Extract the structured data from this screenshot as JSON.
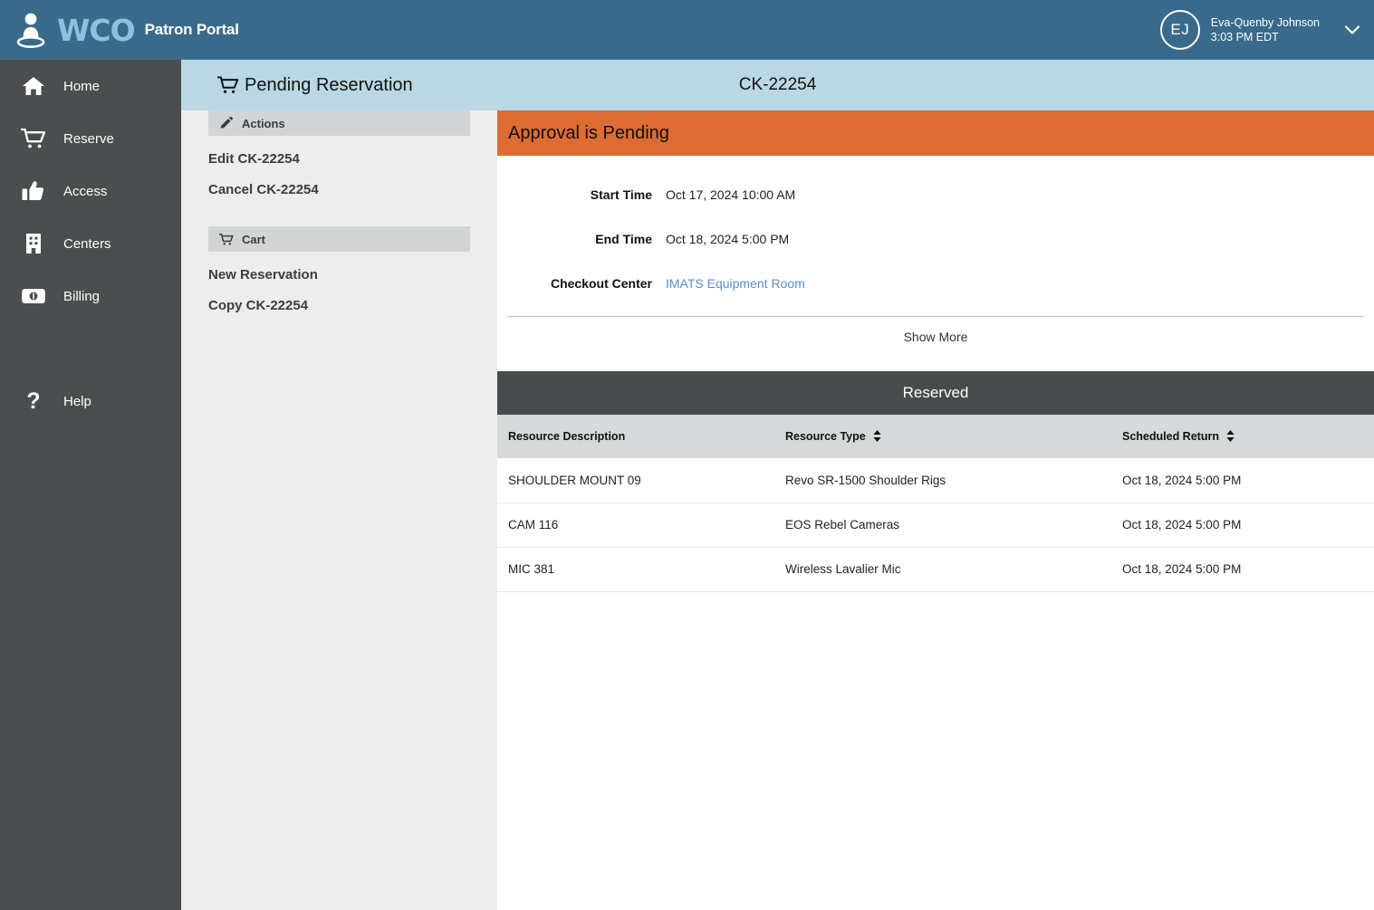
{
  "brand": {
    "logo_icon": "person-location-icon",
    "logo_text": "WCO",
    "subtitle": "Patron Portal"
  },
  "user": {
    "initials": "EJ",
    "name": "Eva-Quenby Johnson",
    "time": "3:03 PM EDT",
    "chevron_icon": "chevron-down-icon"
  },
  "sidebar": {
    "items": [
      {
        "label": "Home",
        "icon": "home-icon"
      },
      {
        "label": "Reserve",
        "icon": "cart-icon"
      },
      {
        "label": "Access",
        "icon": "thumbs-up-icon"
      },
      {
        "label": "Centers",
        "icon": "building-icon"
      },
      {
        "label": "Billing",
        "icon": "banknote-icon"
      },
      {
        "label": "Help",
        "icon": "question-mark-icon"
      }
    ]
  },
  "page_header": {
    "icon": "cart-icon",
    "title": "Pending Reservation",
    "code": "CK-22254"
  },
  "left_panel": {
    "actions": {
      "icon": "pencil-icon",
      "heading": "Actions",
      "links": [
        {
          "label": "Edit CK-22254"
        },
        {
          "label": "Cancel CK-22254"
        }
      ]
    },
    "cart": {
      "icon": "cart-icon",
      "heading": "Cart",
      "links": [
        {
          "label": "New Reservation"
        },
        {
          "label": "Copy CK-22254"
        }
      ]
    }
  },
  "main": {
    "banner": "Approval is Pending",
    "details": [
      {
        "label": "Start Time",
        "value": "Oct 17, 2024 10:00 AM",
        "is_link": false
      },
      {
        "label": "End Time",
        "value": "Oct 18, 2024 5:00 PM",
        "is_link": false
      },
      {
        "label": "Checkout Center",
        "value": "IMATS Equipment Room",
        "is_link": true
      }
    ],
    "show_more": "Show More",
    "reserved_heading": "Reserved",
    "table": {
      "columns": [
        {
          "label": "Resource Description",
          "sortable": false
        },
        {
          "label": "Resource Type",
          "sortable": true
        },
        {
          "label": "Scheduled Return",
          "sortable": true
        }
      ],
      "rows": [
        {
          "description": "SHOULDER MOUNT 09",
          "type": "Revo SR-1500 Shoulder Rigs",
          "scheduled_return": "Oct 18, 2024 5:00 PM"
        },
        {
          "description": "CAM 116",
          "type": "EOS Rebel Cameras",
          "scheduled_return": "Oct 18, 2024 5:00 PM"
        },
        {
          "description": "MIC 381",
          "type": "Wireless Lavalier Mic",
          "scheduled_return": "Oct 18, 2024 5:00 PM"
        }
      ]
    }
  },
  "colors": {
    "topbar_blue": "#3a6a8b",
    "logo_light_blue": "#8cc2dc",
    "sidebar_dark": "#4a4e4e",
    "page_header_light_blue": "#bad8e4",
    "banner_orange": "#dd6c33",
    "panel_bg": "#ededed",
    "panel_head_bg": "#d2d5d6",
    "reserved_bar": "#474b4c",
    "table_head_bg": "#d5d9da",
    "link_blue": "#5b8fc9"
  }
}
